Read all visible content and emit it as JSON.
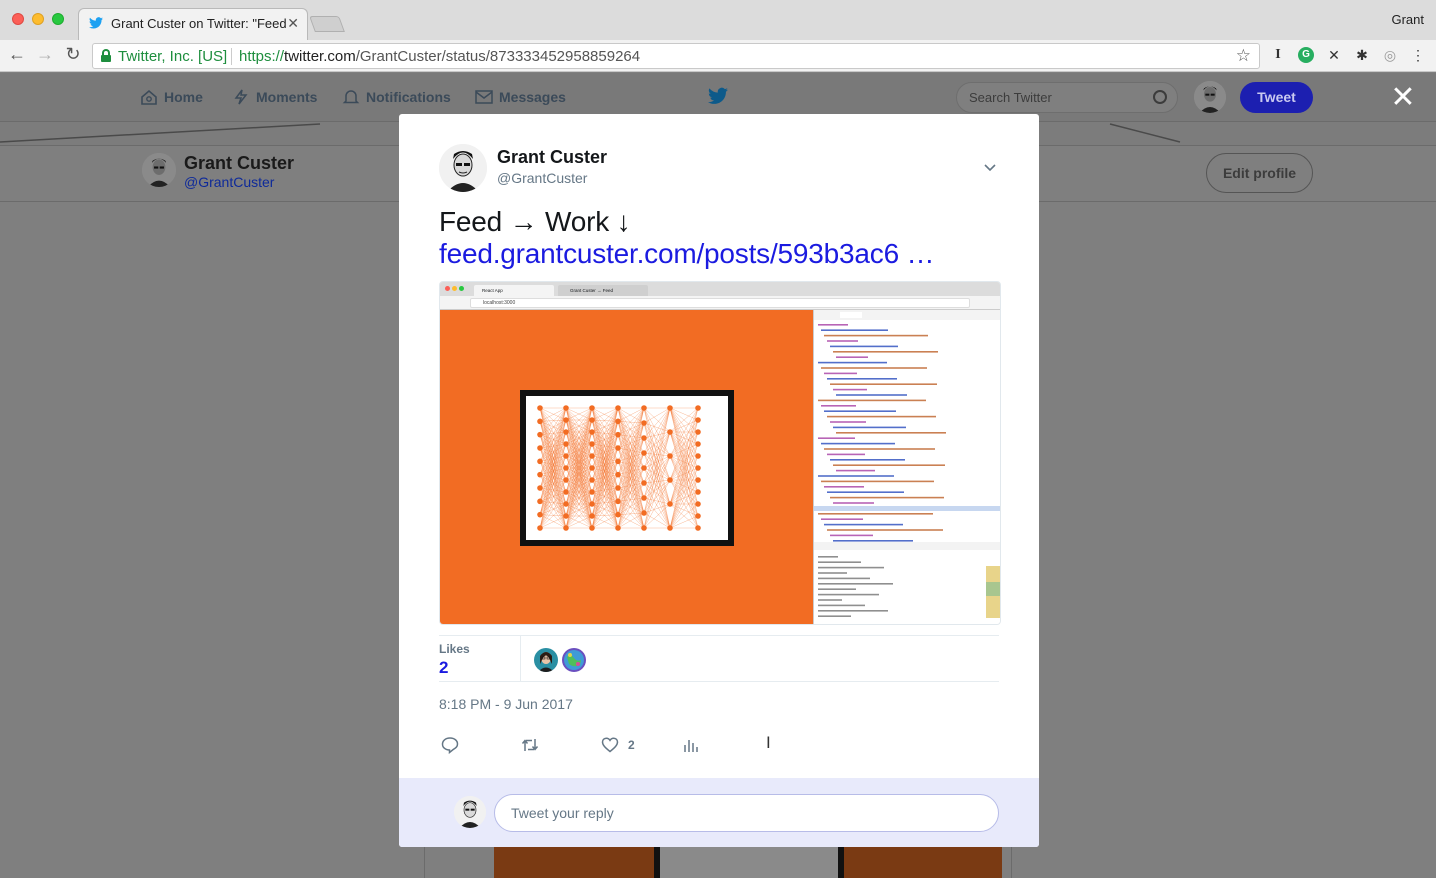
{
  "browser": {
    "tab_title": "Grant Custer on Twitter: \"Feed",
    "tab_close": "✕",
    "profile_name": "Grant",
    "security_org": "Twitter, Inc. [US]",
    "url_scheme": "https://",
    "url_host": "twitter.com",
    "url_path": "/GrantCuster/status/873333452958859264"
  },
  "twitter_nav": {
    "home": "Home",
    "moments": "Moments",
    "notifications": "Notifications",
    "messages": "Messages",
    "search_placeholder": "Search Twitter",
    "tweet_button": "Tweet",
    "close": "✕"
  },
  "profile": {
    "name": "Grant Custer",
    "handle": "@GrantCuster",
    "edit_button": "Edit profile"
  },
  "tweet": {
    "author_name": "Grant Custer",
    "author_handle": "@GrantCuster",
    "text": "Feed → Work ↓",
    "link": "feed.grantcuster.com/posts/593b3ac6 …",
    "likes_label": "Likes",
    "likes_count": "2",
    "timestamp": "8:18 PM - 9 Jun 2017",
    "like_action_count": "2",
    "reply_placeholder": "Tweet your reply",
    "media_tabs": [
      "React App",
      "Grant Custer → Feed"
    ],
    "media_url": "localhost:3000"
  },
  "colors": {
    "twitter_blue": "#1da1f2",
    "link_blue": "#1b1be0",
    "media_orange": "#f26c23",
    "reply_bar": "#e8eafb"
  }
}
